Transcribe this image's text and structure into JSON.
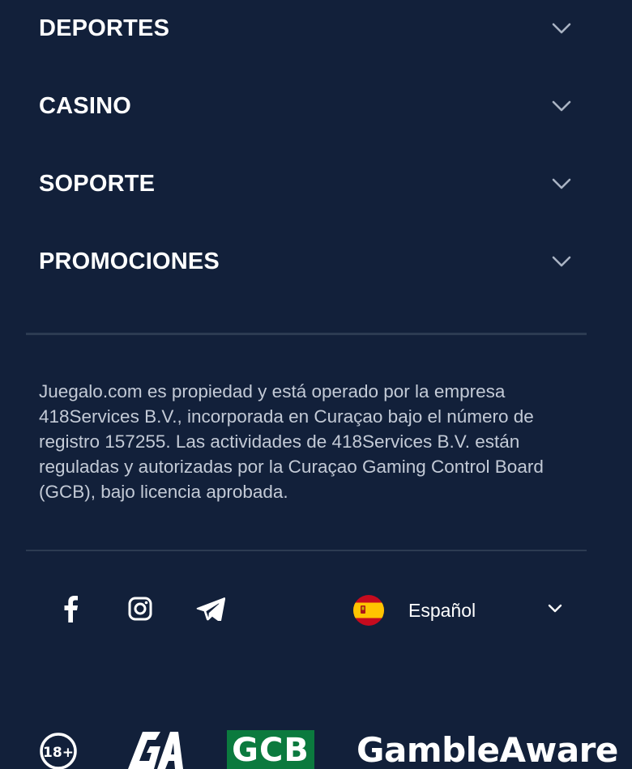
{
  "footer_menu": {
    "items": [
      {
        "label": "DEPORTES"
      },
      {
        "label": "CASINO"
      },
      {
        "label": "SOPORTE"
      },
      {
        "label": "PROMOCIONES"
      }
    ]
  },
  "legal": {
    "text": "Juegalo.com es propiedad y está operado por la empresa 418Services B.V., incorporada en Curaçao bajo el número de registro 157255. Las actividades de 418Services B.V. están reguladas y autorizadas por la Curaçao Gaming Control Board (GCB), bajo licencia aprobada."
  },
  "social": {
    "icons": [
      "facebook-icon",
      "instagram-icon",
      "telegram-icon"
    ]
  },
  "language": {
    "selected": "Español",
    "flag": "spain-flag-icon"
  },
  "badges": {
    "age": "18+",
    "ga_logo": "GA",
    "gcb": "GCB",
    "gamble_aware": "GambleAware"
  },
  "colors": {
    "background": "#12203a",
    "divider": "#2c3b52",
    "text": "#ffffff",
    "legal_text": "#c3cad6",
    "chevron": "#a9b3c3",
    "gcb_green": "#0b7a3e"
  }
}
